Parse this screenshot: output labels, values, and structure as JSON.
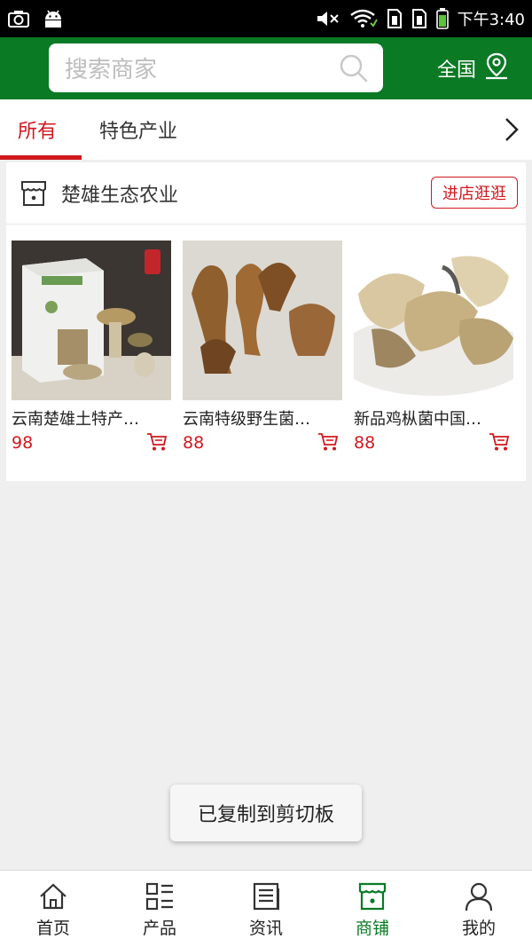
{
  "status_bar": {
    "time": "下午3:40",
    "left_icons": [
      "screenshot-icon",
      "android-icon"
    ],
    "right_icons": [
      "mute-icon",
      "wifi-icon",
      "sim1-icon",
      "sim2-icon",
      "battery-icon"
    ]
  },
  "header": {
    "search_placeholder": "搜索商家",
    "region": "全国"
  },
  "tabs": {
    "items": [
      {
        "label": "所有",
        "active": true
      },
      {
        "label": "特色产业",
        "active": false
      }
    ]
  },
  "shop": {
    "name": "楚雄生态农业",
    "visit_label": "进店逛逛",
    "products": [
      {
        "title": "云南楚雄土特产…",
        "price": "98"
      },
      {
        "title": "云南特级野生菌…",
        "price": "88"
      },
      {
        "title": "新品鸡枞菌中国…",
        "price": "88"
      }
    ]
  },
  "toast": "已复制到剪切板",
  "bottom_nav": {
    "items": [
      {
        "label": "首页",
        "icon": "home-icon",
        "active": false
      },
      {
        "label": "产品",
        "icon": "list-icon",
        "active": false
      },
      {
        "label": "资讯",
        "icon": "news-icon",
        "active": false
      },
      {
        "label": "商铺",
        "icon": "store-icon",
        "active": true
      },
      {
        "label": "我的",
        "icon": "user-icon",
        "active": false
      }
    ]
  },
  "colors": {
    "brand_green": "#0a7a24",
    "accent_red": "#d0191e"
  }
}
